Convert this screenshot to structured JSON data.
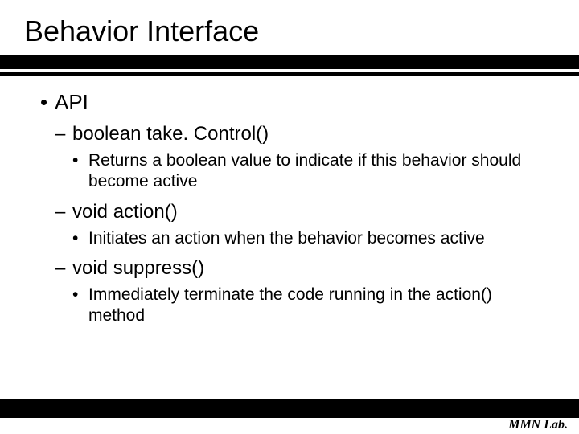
{
  "title": "Behavior Interface",
  "bullets": {
    "api": "API",
    "m1_sig": "boolean take. Control()",
    "m1_desc": "Returns a boolean value to indicate if this behavior should become active",
    "m2_sig": "void action()",
    "m2_desc": "Initiates an action when the behavior becomes active",
    "m3_sig": "void suppress()",
    "m3_desc": "Immediately terminate the code running in the action() method"
  },
  "footer": "MMN Lab."
}
